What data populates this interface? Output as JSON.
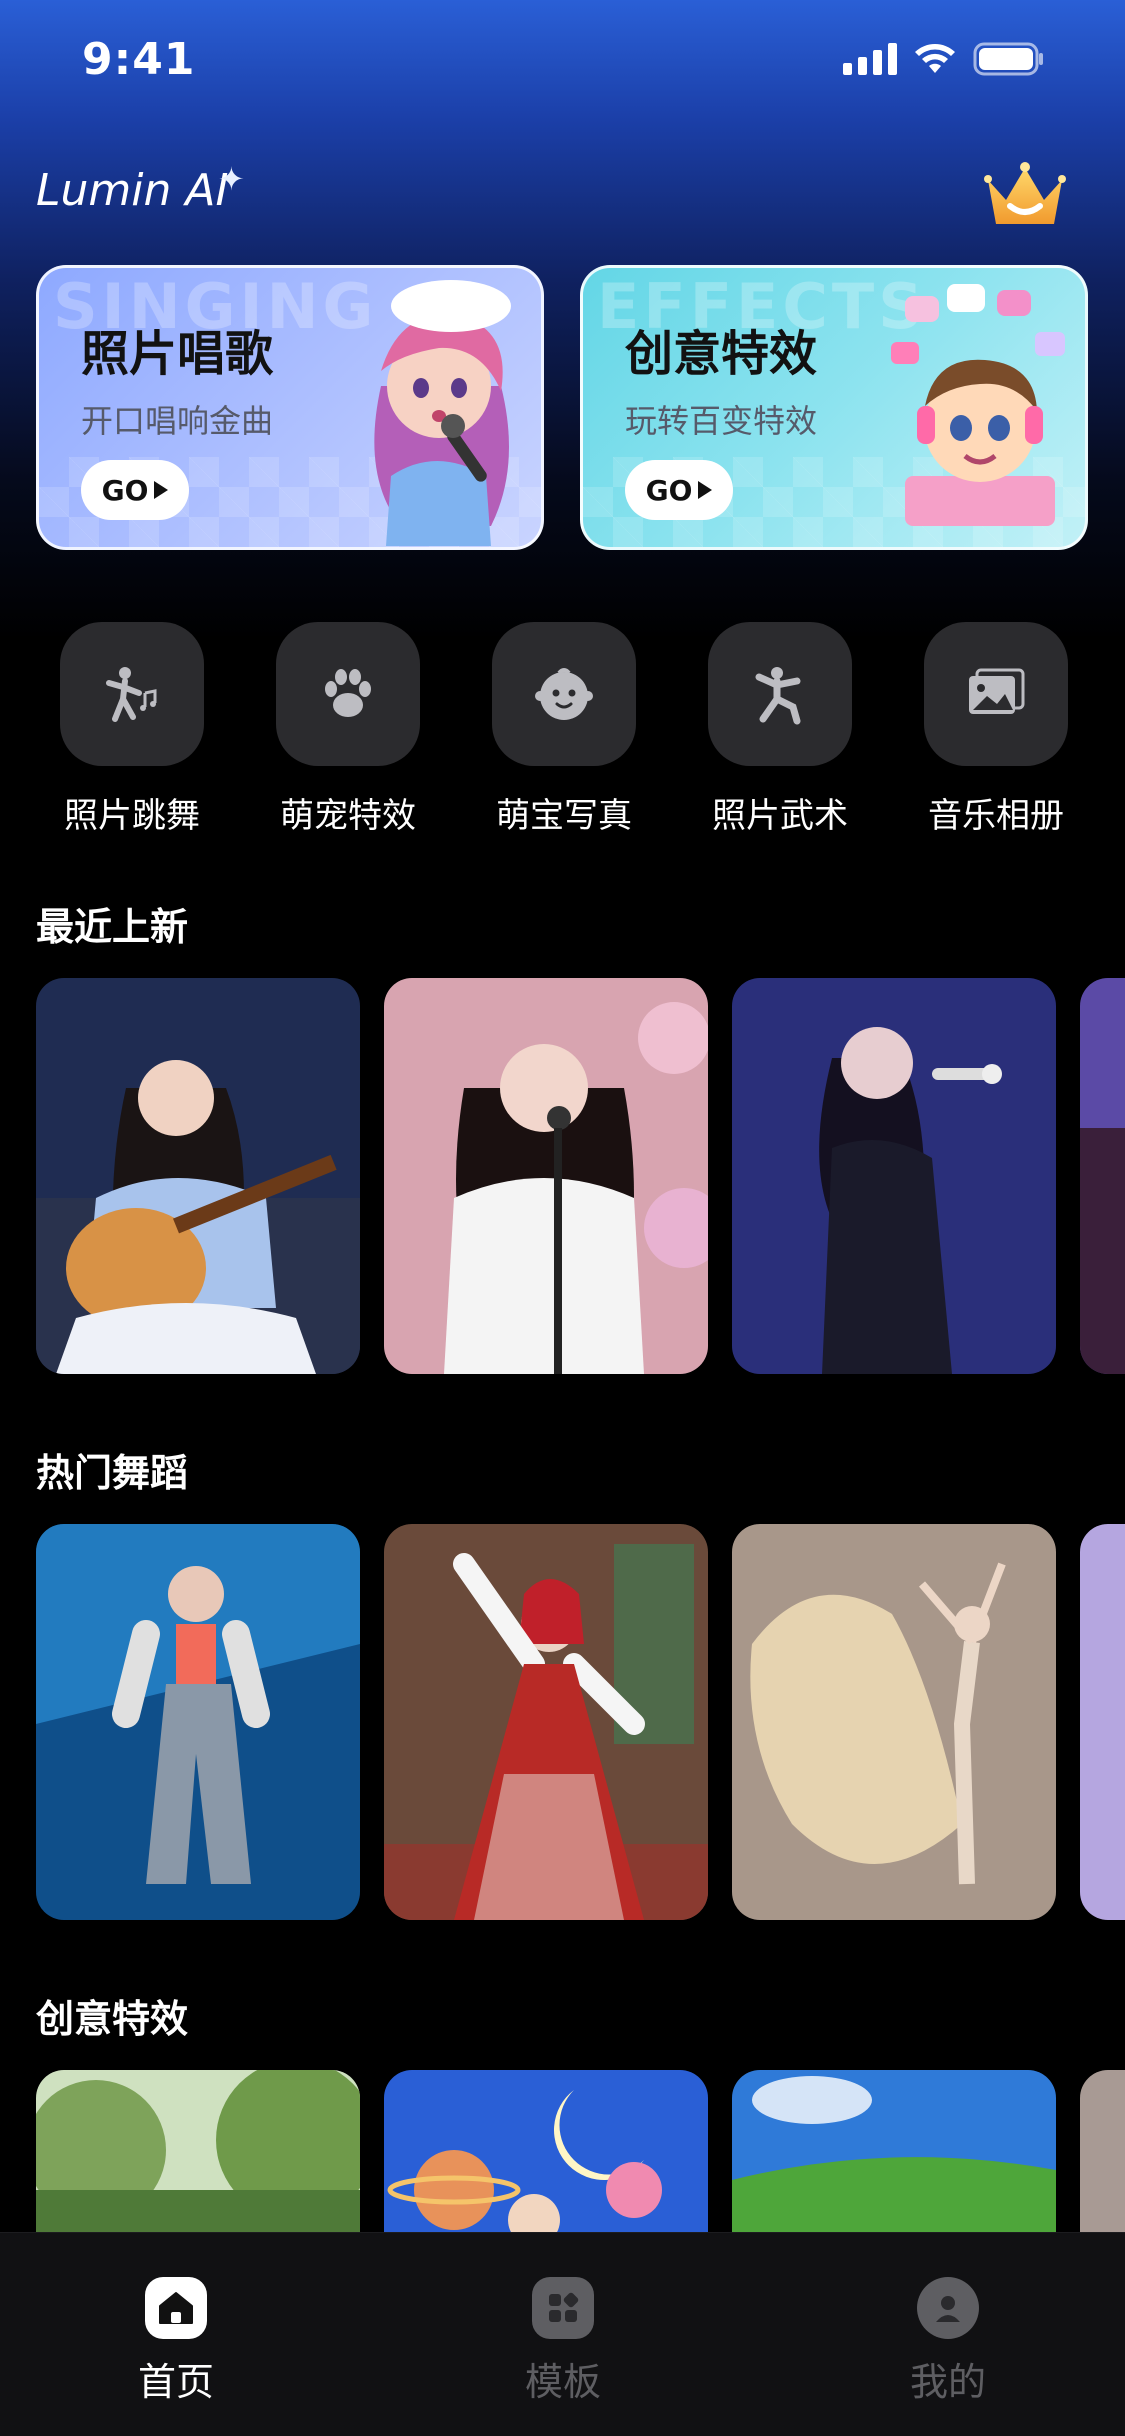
{
  "status": {
    "time": "9:41"
  },
  "header": {
    "logo": "Lumin AI",
    "crown_icon": "crown-icon"
  },
  "banners": [
    {
      "title": "照片唱歌",
      "subtitle": "开口唱响金曲",
      "go": "GO",
      "watermark": "SINGING",
      "color": "#a9bcff"
    },
    {
      "title": "创意特效",
      "subtitle": "玩转百变特效",
      "go": "GO",
      "watermark": "EFFECTS",
      "color": "#8de3ef"
    }
  ],
  "shortcuts": [
    {
      "label": "照片跳舞",
      "icon": "dancing-person-icon"
    },
    {
      "label": "萌宠特效",
      "icon": "paw-icon"
    },
    {
      "label": "萌宝写真",
      "icon": "baby-face-icon"
    },
    {
      "label": "照片武术",
      "icon": "martial-arts-icon"
    },
    {
      "label": "音乐相册",
      "icon": "photo-album-icon"
    }
  ],
  "sections": [
    {
      "title": "最近上新"
    },
    {
      "title": "热门舞蹈"
    },
    {
      "title": "创意特效"
    }
  ],
  "tabs": [
    {
      "label": "首页",
      "icon": "home-icon",
      "active": true
    },
    {
      "label": "模板",
      "icon": "template-icon",
      "active": false
    },
    {
      "label": "我的",
      "icon": "profile-icon",
      "active": false
    }
  ],
  "colors": {
    "active_tab": "#ffffff",
    "inactive_tab": "#5e5e62",
    "tile_bg": "#2b2b2e"
  }
}
